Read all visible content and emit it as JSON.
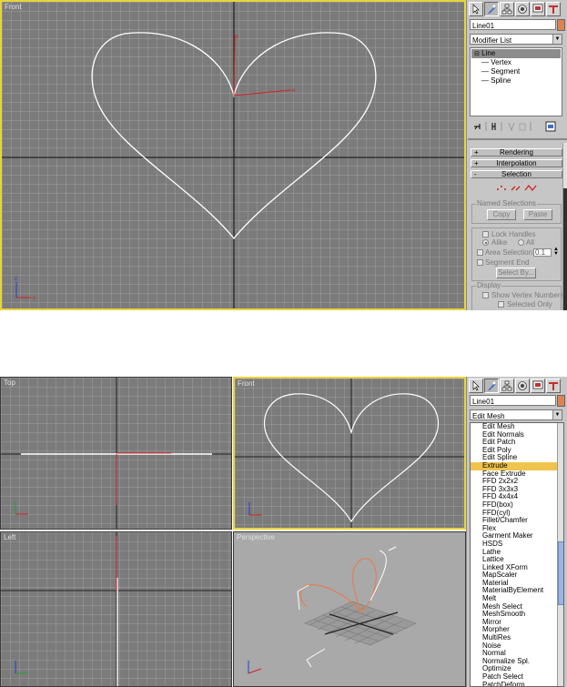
{
  "top": {
    "viewport_label": "Front",
    "name_field": "Line01",
    "modifier_dropdown": "Modifier List",
    "stack": {
      "items": [
        {
          "label": "Line",
          "level": 0
        },
        {
          "label": "Vertex",
          "level": 1
        },
        {
          "label": "Segment",
          "level": 1
        },
        {
          "label": "Spline",
          "level": 1
        }
      ]
    },
    "rollouts": [
      {
        "sign": "+",
        "label": "Rendering"
      },
      {
        "sign": "+",
        "label": "Interpolation"
      },
      {
        "sign": "-",
        "label": "Selection"
      }
    ],
    "named_selections": {
      "title": "Named Selections",
      "copy": "Copy",
      "paste": "Paste"
    },
    "handles": {
      "lock_handles": "Lock Handles",
      "alike": "Alike",
      "all": "All",
      "area_selection": "Area Selection:",
      "area_value": "0.1",
      "segment_end": "Segment End",
      "select_by": "Select By..."
    },
    "display": {
      "title": "Display",
      "show_vertex_numbers": "Show Vertex Numbers",
      "selected_only": "Selected Only"
    }
  },
  "bottom": {
    "viewports": {
      "top": "Top",
      "front": "Front",
      "left": "Left",
      "perspective": "Perspective"
    },
    "name_field": "Line01",
    "modifier_dropdown": "Edit Mesh",
    "modifier_list": {
      "items": [
        "Edit Mesh",
        "Edit Normals",
        "Edit Patch",
        "Edit Poly",
        "Edit Spline",
        "Extrude",
        "Face Extrude",
        "FFD 2x2x2",
        "FFD 3x3x3",
        "FFD 4x4x4",
        "FFD(box)",
        "FFD(cyl)",
        "Fillet/Chamfer",
        "Flex",
        "Garment Maker",
        "HSDS",
        "Lathe",
        "Lattice",
        "Linked XForm",
        "MapScaler",
        "Material",
        "MaterialByElement",
        "Melt",
        "Mesh Select",
        "MeshSmooth",
        "Mirror",
        "Morpher",
        "MultiRes",
        "Noise",
        "Normal",
        "Normalize Spl.",
        "Optimize",
        "Patch Select",
        "PatchDeform"
      ],
      "selected": "Extrude"
    }
  },
  "colors": {
    "viewport_bg": "#7b7b7b",
    "active_border": "#e8d43c",
    "panel_bg": "#c6c6c6",
    "object_swatch": "#e08250",
    "selected_item": "#f0c44c"
  },
  "icons": [
    "select-arrow-icon",
    "modify-icon",
    "hierarchy-icon",
    "motion-icon",
    "display-icon",
    "utilities-icon",
    "pin-stack-icon",
    "show-end-result-icon",
    "make-unique-icon",
    "remove-modifier-icon",
    "configure-sets-icon",
    "vertex-mode-icon",
    "segment-mode-icon",
    "spline-mode-icon"
  ]
}
